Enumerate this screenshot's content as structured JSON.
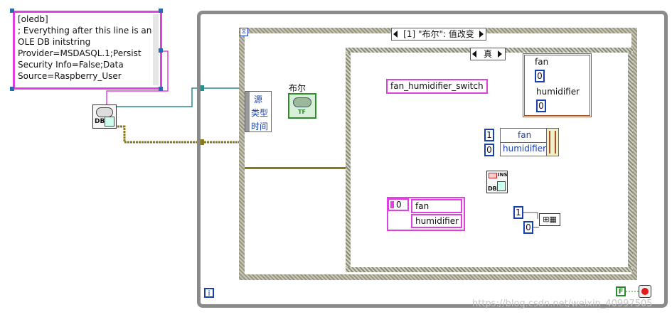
{
  "connection_string": {
    "lines": [
      "[oledb]",
      "; Everything after this line is an",
      "OLE DB initstring",
      "Provider=MSDASQL.1;Persist",
      "Security Info=False;Data",
      "Source=Raspberry_User"
    ]
  },
  "open_connection_vi": {
    "icon": "db-open-icon",
    "label": "DB"
  },
  "event_structure": {
    "case_label": "[1] \"布尔\": 值改变",
    "timeout_icon": "hourglass-icon",
    "iteration_icon": "i",
    "event_data": [
      "源",
      "类型",
      "时间"
    ]
  },
  "boolean_control": {
    "label": "布尔",
    "led_text": "TF"
  },
  "case_structure": {
    "selector_label": "真"
  },
  "table_name_constant": "fan_humidifier_switch",
  "data_cluster": {
    "fields": [
      {
        "name": "fan",
        "value": "0"
      },
      {
        "name": "humidifier",
        "value": "0"
      }
    ]
  },
  "bundle": {
    "rows": [
      {
        "index": "1",
        "name": "fan"
      },
      {
        "index": "0",
        "name": "humidifier"
      }
    ]
  },
  "insert_vi": {
    "label": "DB",
    "badge": "INS"
  },
  "column_array": {
    "index": "0",
    "items": [
      "fan",
      "humidifier"
    ]
  },
  "array_constant": {
    "index": "1",
    "subindex": "0"
  },
  "stop": {
    "bool": "F",
    "icon": "stop-icon"
  },
  "watermark": "https://blog.csdn.net/weixin_40997505",
  "colors": {
    "structure_gray": "#8a8a8a",
    "string_pink": "#e040e0",
    "int_blue": "#1a3fb0",
    "refnum_teal": "#2a8c8c",
    "error_olive": "#8a7a1a",
    "cluster_brown": "#a0522d"
  }
}
